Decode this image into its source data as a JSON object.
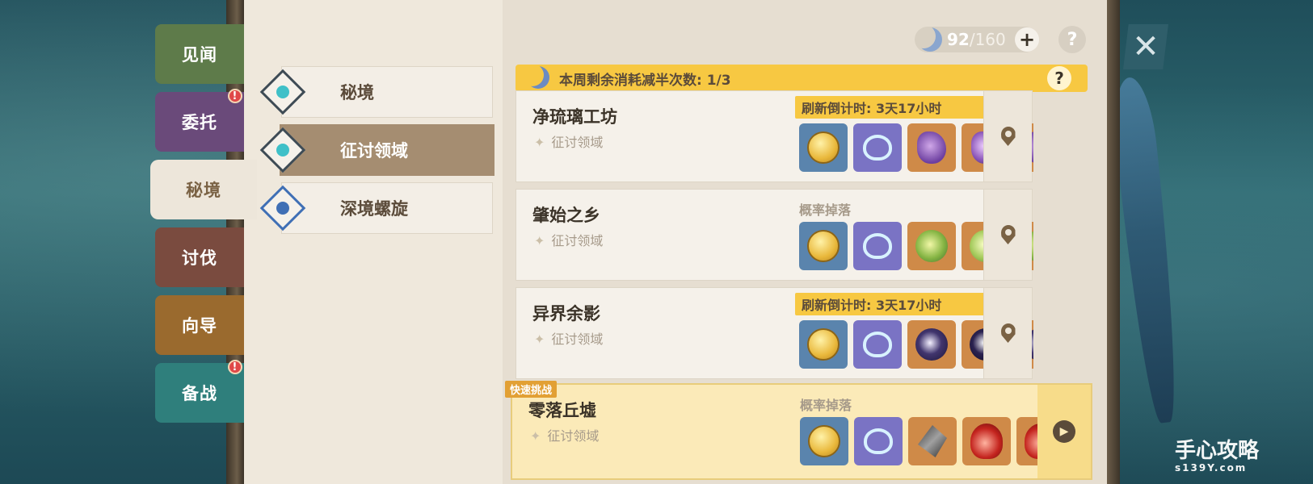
{
  "side_tabs": [
    {
      "label": "见闻",
      "color": "#5e7b4a",
      "badge": false
    },
    {
      "label": "委托",
      "color": "#6a4a7a",
      "badge": true
    },
    {
      "label": "秘境",
      "color": "#ede6da",
      "badge": false,
      "active": true
    },
    {
      "label": "讨伐",
      "color": "#7a4b3f",
      "badge": false
    },
    {
      "label": "向导",
      "color": "#9a6a2e",
      "badge": false
    },
    {
      "label": "备战",
      "color": "#2f7f7c",
      "badge": true
    }
  ],
  "badge_mark": "!",
  "subnav": [
    {
      "label": "秘境",
      "active": false
    },
    {
      "label": "征讨领域",
      "active": true
    },
    {
      "label": "深境螺旋",
      "active": false
    }
  ],
  "resin": {
    "current": "92",
    "max": "/160"
  },
  "plus": "+",
  "help_mark": "?",
  "close_mark": "✕",
  "weekly_text": "本周剩余消耗减半次数: 1/3",
  "domains": [
    {
      "title": "净琉璃工坊",
      "type": "征讨领域",
      "tag": "刷新倒计时: 3天17小时",
      "tag_style": "countdown",
      "items": [
        "coin",
        "heart",
        "purple-art",
        "purple-art2",
        "purple-art3"
      ]
    },
    {
      "title": "肇始之乡",
      "type": "征讨领域",
      "tag": "概率掉落",
      "tag_style": "drop",
      "items": [
        "coin",
        "heart",
        "green-art",
        "green-art2",
        "green-art3"
      ]
    },
    {
      "title": "异界余影",
      "type": "征讨领域",
      "tag": "刷新倒计时: 3天17小时",
      "tag_style": "countdown",
      "items": [
        "coin",
        "heart",
        "dark-art",
        "dark-art2",
        "dark-art3"
      ]
    },
    {
      "title": "零落丘墟",
      "type": "征讨领域",
      "tag": "概率掉落",
      "tag_style": "drop",
      "items": [
        "coin",
        "heart",
        "sword-art",
        "red-art",
        "red-art2"
      ]
    }
  ],
  "quick_challenge": "快速挑战",
  "diamond_mark": "✦",
  "play_mark": "▶",
  "watermark": {
    "main": "手心攻略",
    "sub": "s139Y.com"
  }
}
